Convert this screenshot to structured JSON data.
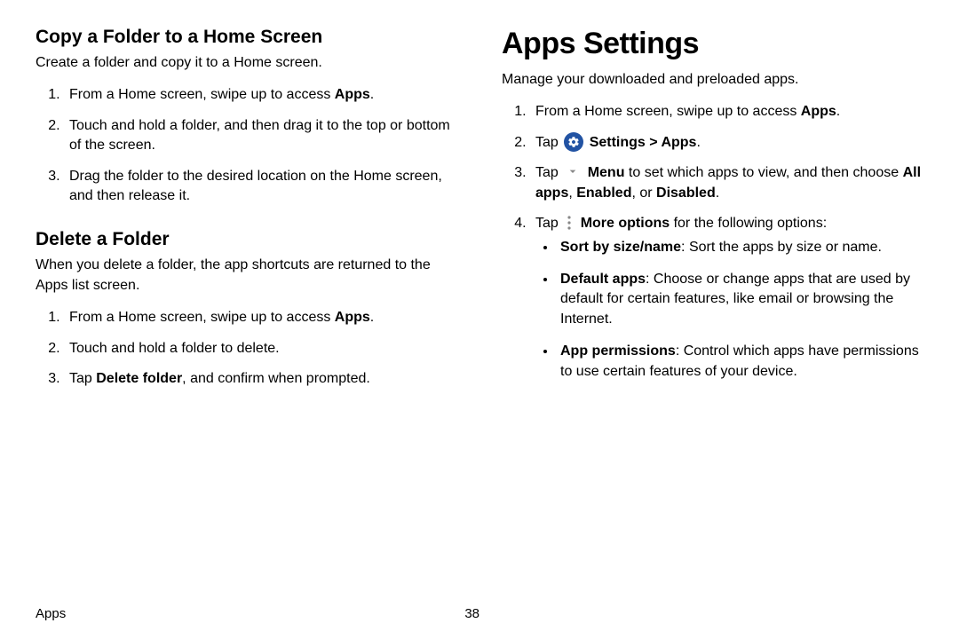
{
  "left": {
    "section1": {
      "heading": "Copy a Folder to a Home Screen",
      "intro": "Create a folder and copy it to a Home screen.",
      "steps": {
        "s1a": "From a Home screen, swipe up to access ",
        "s1b": "Apps",
        "s1c": ".",
        "s2": "Touch and hold a folder, and then drag it to the top or bottom of the screen.",
        "s3": "Drag the folder to the desired location on the Home screen, and then release it."
      }
    },
    "section2": {
      "heading": "Delete a Folder",
      "intro": "When you delete a folder, the app shortcuts are returned to the Apps list screen.",
      "steps": {
        "s1a": "From a Home screen, swipe up to access ",
        "s1b": "Apps",
        "s1c": ".",
        "s2": "Touch and hold a folder to delete.",
        "s3a": "Tap ",
        "s3b": "Delete folder",
        "s3c": ", and confirm when prompted."
      }
    }
  },
  "right": {
    "heading": "Apps Settings",
    "intro": "Manage your downloaded and preloaded apps.",
    "steps": {
      "s1a": "From a Home screen, swipe up to access ",
      "s1b": "Apps",
      "s1c": ".",
      "s2a": "Tap ",
      "s2b": " Settings > Apps",
      "s2c": ".",
      "s3a": "Tap ",
      "s3b": " Menu",
      "s3c": " to set which apps to view, and then choose ",
      "s3d": "All apps",
      "s3e": ", ",
      "s3f": "Enabled",
      "s3g": ", or ",
      "s3h": "Disabled",
      "s3i": ".",
      "s4a": "Tap ",
      "s4b": " More options",
      "s4c": " for the following options:"
    },
    "bullets": {
      "b1a": "Sort by size/name",
      "b1b": ": Sort the apps by size or name.",
      "b2a": "Default apps",
      "b2b": ": Choose or change apps that are used by default for certain features, like email or browsing the Internet.",
      "b3a": "App permissions",
      "b3b": ": Control which apps have permissions to use certain features of your device."
    }
  },
  "footer": {
    "section": "Apps",
    "page": "38"
  }
}
